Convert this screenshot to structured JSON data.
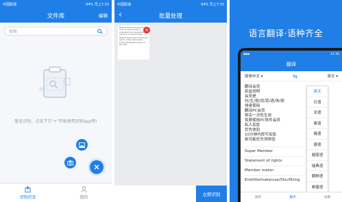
{
  "panel1": {
    "status": {
      "left": "中国联通",
      "right": "94% 早上7:33"
    },
    "title": "文件库",
    "edit": "编辑",
    "search_placeholder": "搜索",
    "empty_text": "暂无识别，点击下方\"+\"开始使用识别app吧!",
    "tabs": [
      {
        "label": "识别历史"
      },
      {
        "label": "我的"
      }
    ],
    "colors": {
      "primary": "#1f7fe6",
      "fab_close": "#1f7fe6"
    }
  },
  "panel2": {
    "status": {
      "left": "中国联通",
      "right": "94% 早上7:33"
    },
    "title": "批量处理",
    "doc_text": [
      "Medical historical books are the most convenient way to understand the development of medicine in ancient times.",
      "Medical books were used by the author of this article when writing the English version of the book."
    ],
    "recognize_button": "立即识别"
  },
  "panel3": {
    "slogan": "语言翻译·语种齐全",
    "phone_status": {
      "right": "12:30"
    },
    "phone_title": "翻译",
    "source_lang": "简体中文",
    "target_lang": "英文",
    "cn_lines": [
      "翻译会员",
      "权益说明",
      "会员是",
      "抖/生/按/消/赏/语/体/按",
      "排身使用",
      "翻译PC会员",
      "购买一次性生效",
      "免费使用PC软件会员",
      "私人加急",
      "优先体验",
      "10分钟内即可加急",
      "新功能优先测体验"
    ],
    "en_lines": [
      "Super Member",
      "Statement of rights",
      "Member melon",
      "End/life/make/use/Shu/fit/ing"
    ],
    "languages": [
      "英文",
      "日语",
      "法语",
      "泰语",
      "俄语",
      "德语",
      "越南语",
      "瑞典语",
      "朝鲜语",
      "希腊语",
      "荷兰语"
    ],
    "bottom_tabs": [
      "复制",
      "翻译",
      "收藏"
    ]
  }
}
